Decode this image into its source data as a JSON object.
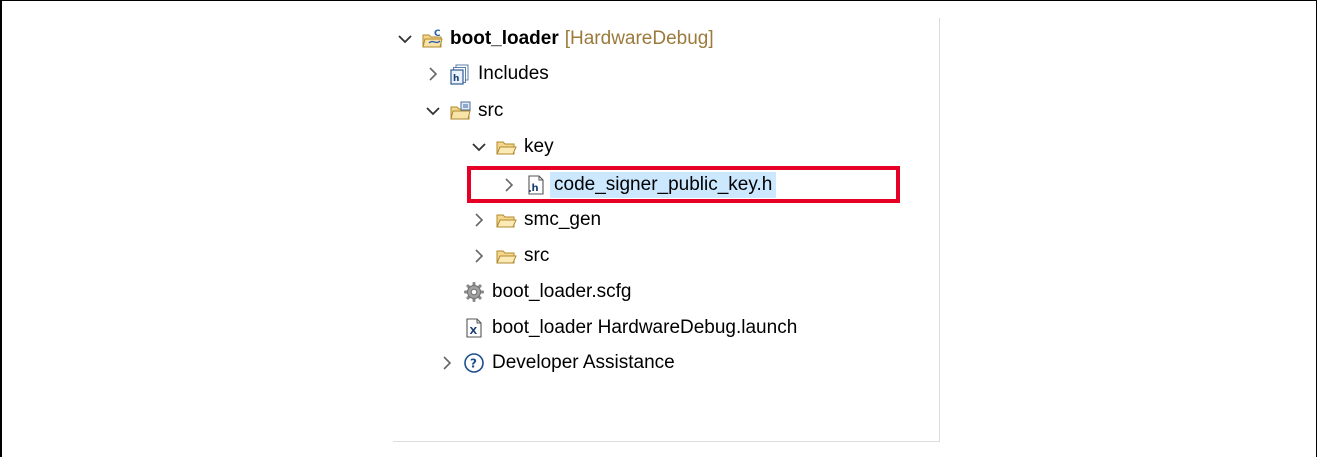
{
  "tree": {
    "project": {
      "name": "boot_loader",
      "config": "[HardwareDebug]",
      "icon": "c-project-icon",
      "expanded": true
    },
    "items": [
      {
        "label": "Includes",
        "icon": "includes-icon",
        "expanded": false
      },
      {
        "label": "src",
        "icon": "source-folder-icon",
        "expanded": true
      },
      {
        "label": "key",
        "icon": "folder-icon",
        "expanded": true
      },
      {
        "label": "code_signer_public_key.h",
        "icon": "header-file-icon",
        "expanded": false,
        "selected": true
      },
      {
        "label": "smc_gen",
        "icon": "folder-icon",
        "expanded": false
      },
      {
        "label": "src",
        "icon": "folder-icon",
        "expanded": false
      },
      {
        "label": "boot_loader.scfg",
        "icon": "gear-icon"
      },
      {
        "label": "boot_loader HardwareDebug.launch",
        "icon": "launch-file-icon"
      },
      {
        "label": "Developer Assistance",
        "icon": "help-icon",
        "expanded": false
      }
    ]
  },
  "colors": {
    "highlight_border": "#e60026",
    "selection_bg": "#cce8ff",
    "decoration_text": "#9b7a3c",
    "folder_fill": "#f5d68a",
    "folder_stroke": "#b08a2e"
  }
}
